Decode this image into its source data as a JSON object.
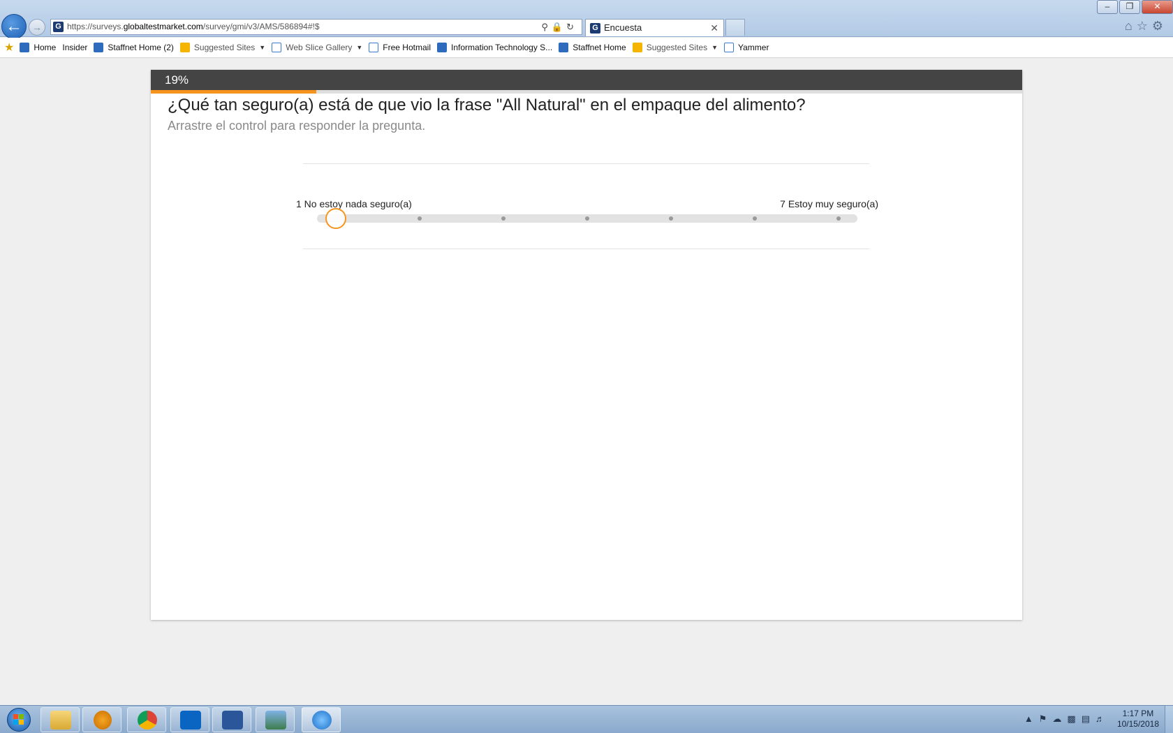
{
  "browser": {
    "address": {
      "scheme": "https://",
      "sub": "surveys.",
      "host": "globaltestmarket.com",
      "path": "/survey/gmi/v3/AMS/586894#!$"
    },
    "tab_title": "Encuesta",
    "favorites": [
      {
        "label": "Home",
        "icon": "sharepoint-icon"
      },
      {
        "label": "Insider",
        "icon": null
      },
      {
        "label": "Staffnet Home (2)",
        "icon": "sharepoint-icon"
      },
      {
        "label": "Suggested Sites",
        "icon": "bing-icon",
        "dropdown": true
      },
      {
        "label": "Web Slice Gallery",
        "icon": "ie-page-icon",
        "dropdown": true
      },
      {
        "label": "Free Hotmail",
        "icon": "ie-page-icon"
      },
      {
        "label": "Information Technology S...",
        "icon": "sharepoint-icon"
      },
      {
        "label": "Staffnet Home",
        "icon": "sharepoint-icon"
      },
      {
        "label": "Suggested Sites",
        "icon": "bing-icon",
        "dropdown": true
      },
      {
        "label": "Yammer",
        "icon": "ie-page-icon"
      }
    ]
  },
  "survey": {
    "progress_label": "19%",
    "progress_fraction": 0.19,
    "question": "¿Qué tan seguro(a) está de que vio la frase \"All Natural\" en el empaque del alimento?",
    "instruction": "Arrastre el control para responder la pregunta.",
    "slider": {
      "min_label": "1 No estoy nada seguro(a)",
      "max_label": "7 Estoy muy seguro(a)",
      "min": 1,
      "max": 7,
      "value": 1
    }
  },
  "taskbar": {
    "apps": [
      "windows-explorer",
      "media-player",
      "chrome",
      "outlook",
      "word",
      "photo-viewer",
      "internet-explorer"
    ],
    "time": "1:17 PM",
    "date": "10/15/2018"
  },
  "colors": {
    "accent": "#f7941d",
    "header_bar": "#444444"
  }
}
